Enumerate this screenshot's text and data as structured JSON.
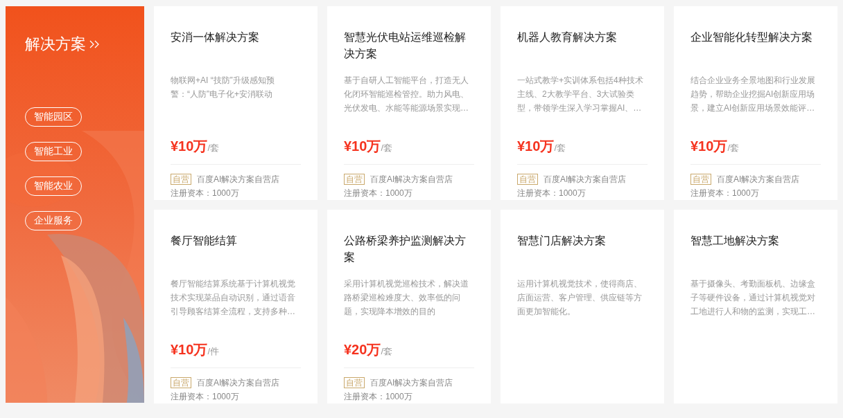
{
  "banner": {
    "title": "解决方案",
    "tags": [
      {
        "label": "智能园区"
      },
      {
        "label": "智能工业"
      },
      {
        "label": "智能农业"
      },
      {
        "label": "企业服务"
      }
    ]
  },
  "cards": [
    {
      "title": "安消一体解决方案",
      "description": "物联网+AI “技防”升级感知预警：“人防”电子化+安消联动",
      "price": "¥10万",
      "unit": "/套",
      "badge": "自营",
      "shop": "百度AI解决方案自营店",
      "capital": "注册资本：1000万"
    },
    {
      "title": "智慧光伏电站运维巡检解决方案",
      "description": "基于自研人工智能平台，打造无人化闭环智能巡检管控。助力风电、光伏发电、水能等能源场景实现…",
      "price": "¥10万",
      "unit": "/套",
      "badge": "自营",
      "shop": "百度AI解决方案自营店",
      "capital": "注册资本：1000万"
    },
    {
      "title": "机器人教育解决方案",
      "description": "一站式教学+实训体系包括4种技术主线、2大教学平台、3大试验类型，带领学生深入学习掌握AI、…",
      "price": "¥10万",
      "unit": "/套",
      "badge": "自营",
      "shop": "百度AI解决方案自营店",
      "capital": "注册资本：1000万"
    },
    {
      "title": "企业智能化转型解决方案",
      "description": "结合企业业务全景地图和行业发展趋势，帮助企业挖掘AI创新应用场景，建立AI创新应用场景效能评…",
      "price": "¥10万",
      "unit": "/套",
      "badge": "自营",
      "shop": "百度AI解决方案自营店",
      "capital": "注册资本：1000万"
    },
    {
      "title": "餐厅智能结算",
      "description": "餐厅智能结算系统基于计算机视觉技术实现菜品自动识别，通过语音引导顾客结算全流程，支持多种…",
      "price": "¥10万",
      "unit": "/件",
      "badge": "自营",
      "shop": "百度AI解决方案自营店",
      "capital": "注册资本：1000万"
    },
    {
      "title": "公路桥梁养护监测解决方案",
      "description": "采用计算机视觉巡检技术，解决道路桥梁巡检难度大、效率低的问题，实现降本增效的目的",
      "price": "¥20万",
      "unit": "/套",
      "badge": "自营",
      "shop": "百度AI解决方案自营店",
      "capital": "注册资本：1000万"
    },
    {
      "title": "智慧门店解决方案",
      "description": "运用计算机视觉技术，使得商店、店面运营、客户管理、供应链等方面更加智能化。"
    },
    {
      "title": "智慧工地解决方案",
      "description": "基于摄像头、考勤面板机、边缘盒子等硬件设备，通过计算机视觉对工地进行人和物的监测，实现工…"
    }
  ]
}
